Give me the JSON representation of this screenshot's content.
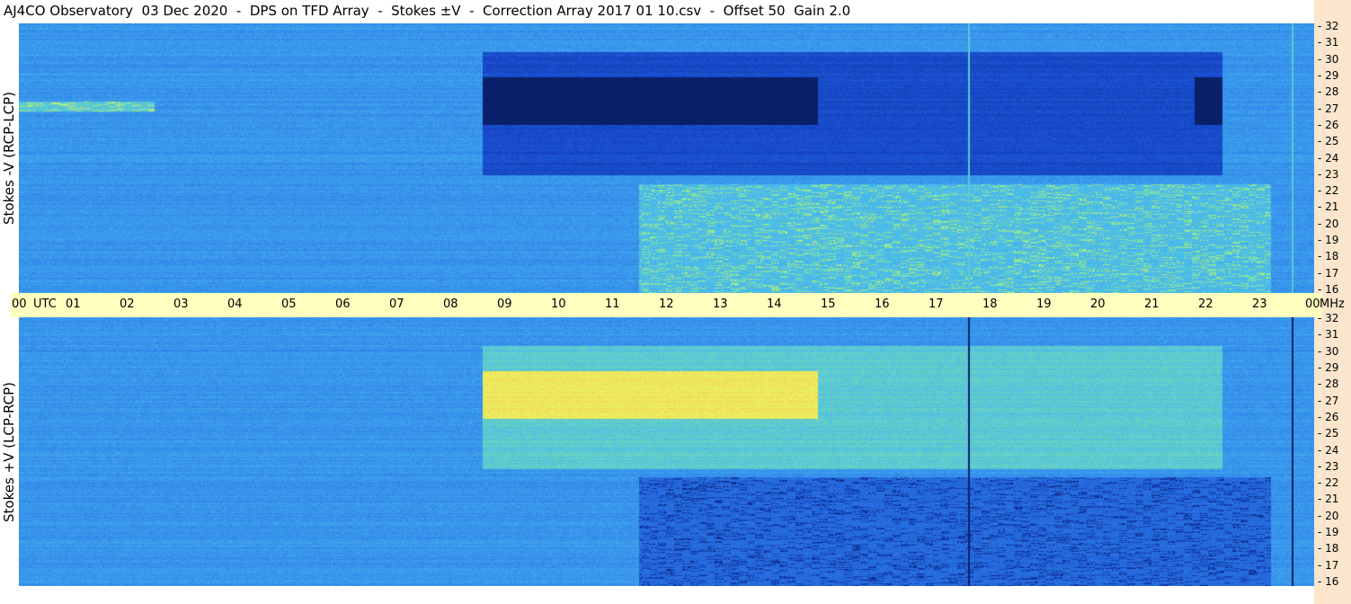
{
  "title": "AJ4CO Observatory  03 Dec 2020  -  DPS on TFD Array  -  Stokes ±V  -  Correction Array 2017 01 10.csv  -  Offset 50  Gain 2.0",
  "colors": {
    "background": "#ffffff",
    "time_axis_bg": "#ffffc0",
    "freq_axis_bg": "#fbe5cc",
    "spectrogram_base": "#2e7fe8"
  },
  "chart_data": [
    {
      "type": "heatmap",
      "name": "Stokes -V (RCP-LCP)",
      "ylabel": "Stokes -V (RCP-LCP)",
      "x_unit": "UTC",
      "y_unit": "MHz",
      "xlim": [
        0,
        24
      ],
      "ylim": [
        16,
        32
      ],
      "colormap": [
        "#0a1f6a",
        "#1646c8",
        "#2e7fe8",
        "#48b8f0",
        "#8cf08c",
        "#f0f060",
        "#ff7020"
      ],
      "features": [
        {
          "kind": "dark band",
          "t0": 8.6,
          "t1": 22.3,
          "f0": 23.0,
          "f1": 30.3,
          "level": 0.18
        },
        {
          "kind": "dark band",
          "t0": 8.6,
          "t1": 14.8,
          "f0": 26.0,
          "f1": 28.8,
          "level": 0.08
        },
        {
          "kind": "dark band",
          "t0": 21.8,
          "t1": 22.3,
          "f0": 26.0,
          "f1": 28.8,
          "level": 0.08
        },
        {
          "kind": "bright emission",
          "t0": 11.5,
          "t1": 23.2,
          "f0": 16.0,
          "f1": 22.5,
          "level": 0.62
        },
        {
          "kind": "bright emission",
          "t0": 0.0,
          "t1": 2.5,
          "f0": 26.8,
          "f1": 27.4,
          "level": 0.7
        },
        {
          "kind": "bright line",
          "t": 17.6,
          "level": 0.55
        },
        {
          "kind": "bright line",
          "t": 23.6,
          "level": 0.55
        }
      ]
    },
    {
      "type": "heatmap",
      "name": "Stokes +V (LCP-RCP)",
      "ylabel": "Stokes +V (LCP-RCP)",
      "x_unit": "UTC",
      "y_unit": "MHz",
      "xlim": [
        0,
        24
      ],
      "ylim": [
        16,
        32
      ],
      "colormap": [
        "#0a1f6a",
        "#1646c8",
        "#2e7fe8",
        "#48b8f0",
        "#8cf08c",
        "#f0f060",
        "#ff7020"
      ],
      "features": [
        {
          "kind": "bright band",
          "t0": 8.6,
          "t1": 22.3,
          "f0": 23.0,
          "f1": 30.3,
          "level": 0.55
        },
        {
          "kind": "bright band",
          "t0": 8.6,
          "t1": 14.8,
          "f0": 26.0,
          "f1": 28.8,
          "level": 0.72
        },
        {
          "kind": "dark absorption",
          "t0": 11.5,
          "t1": 23.2,
          "f0": 16.0,
          "f1": 22.5,
          "level": 0.15
        },
        {
          "kind": "dark line",
          "t": 17.6,
          "level": 0.0
        },
        {
          "kind": "dark line",
          "t": 23.6,
          "level": 0.0
        }
      ]
    }
  ],
  "time_axis": {
    "labels": [
      "00",
      "UTC",
      "01",
      "02",
      "03",
      "04",
      "05",
      "06",
      "07",
      "08",
      "09",
      "10",
      "11",
      "12",
      "13",
      "14",
      "15",
      "16",
      "17",
      "18",
      "19",
      "20",
      "21",
      "22",
      "23",
      "00",
      "MHz"
    ]
  },
  "freq_axis": {
    "labels": [
      "32",
      "31",
      "30",
      "29",
      "28",
      "27",
      "26",
      "25",
      "24",
      "23",
      "22",
      "21",
      "20",
      "19",
      "18",
      "17",
      "16"
    ]
  }
}
